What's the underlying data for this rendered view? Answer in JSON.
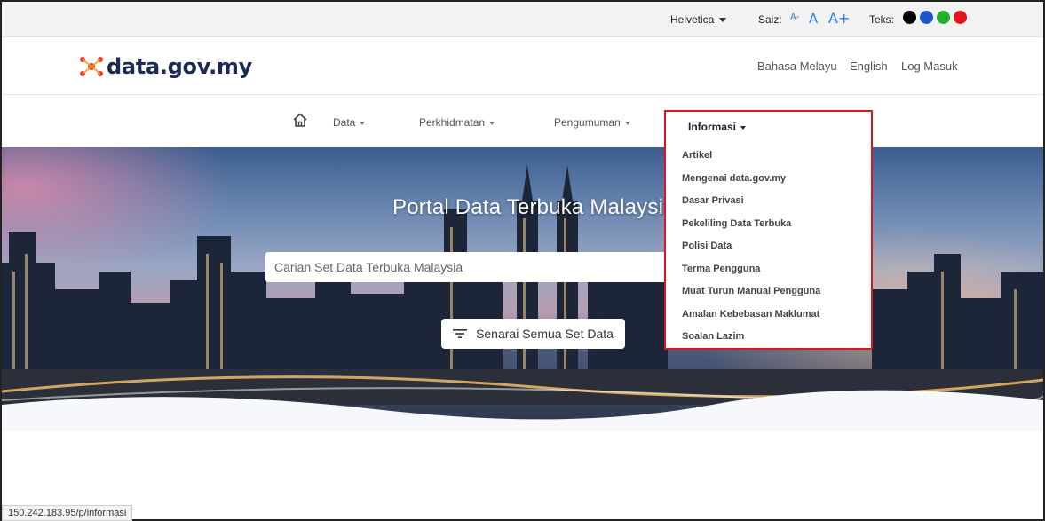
{
  "topbar": {
    "font_select": "Helvetica",
    "saiz_label": "Saiz:",
    "size_small": "A-",
    "size_normal": "A",
    "size_large": "A+",
    "teks_label": "Teks:",
    "text_colors": [
      "#000000",
      "#1a56c8",
      "#22b12c",
      "#e3141b"
    ]
  },
  "header": {
    "logo_text": "data.gov.my",
    "links": [
      "Bahasa Melayu",
      "English",
      "Log Masuk"
    ]
  },
  "nav": {
    "items": [
      "Data",
      "Perkhidmatan",
      "Pengumuman",
      "Informasi"
    ]
  },
  "hero": {
    "title": "Portal Data Terbuka Malaysia",
    "search_placeholder": "Carian Set Data Terbuka Malaysia",
    "all_data_button": "Senarai Semua Set Data"
  },
  "dropdown": {
    "items": [
      "Artikel",
      "Mengenai data.gov.my",
      "Dasar Privasi",
      "Pekeliling Data Terbuka",
      "Polisi Data",
      "Terma Pengguna",
      "Muat Turun Manual Pengguna",
      "Amalan Kebebasan Maklumat",
      "Soalan Lazim"
    ]
  },
  "status": {
    "url": "150.242.183.95/p/informasi"
  },
  "colors": {
    "brand_navy": "#1a2a55",
    "accent_blue": "#2d7bf4",
    "highlight_red": "#e0141b"
  }
}
